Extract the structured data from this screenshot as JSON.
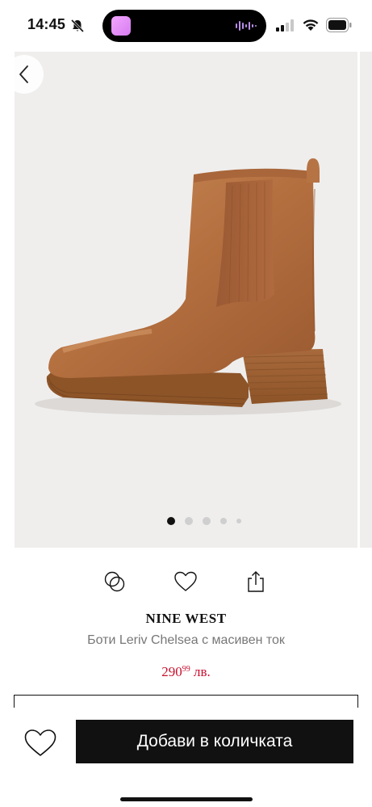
{
  "status_bar": {
    "time": "14:45",
    "icons": [
      "bell-slash-icon",
      "signal-icon",
      "wifi-icon",
      "battery-icon"
    ]
  },
  "gallery": {
    "image": "brown leather chelsea boot with block heel",
    "total_images": 5,
    "active_index": 0
  },
  "actions": {
    "icons": [
      "compare-icon",
      "heart-icon",
      "share-icon"
    ]
  },
  "product": {
    "brand": "NINE WEST",
    "name": "Боти Leriv Chelsea с масивен ток",
    "price_main": "290",
    "price_cents": "99",
    "currency": " лв."
  },
  "cart": {
    "add_label": "Добави в количката"
  },
  "colors": {
    "price": "#c8102e",
    "button_bg": "#111111",
    "hero_bg": "#efeeed"
  }
}
